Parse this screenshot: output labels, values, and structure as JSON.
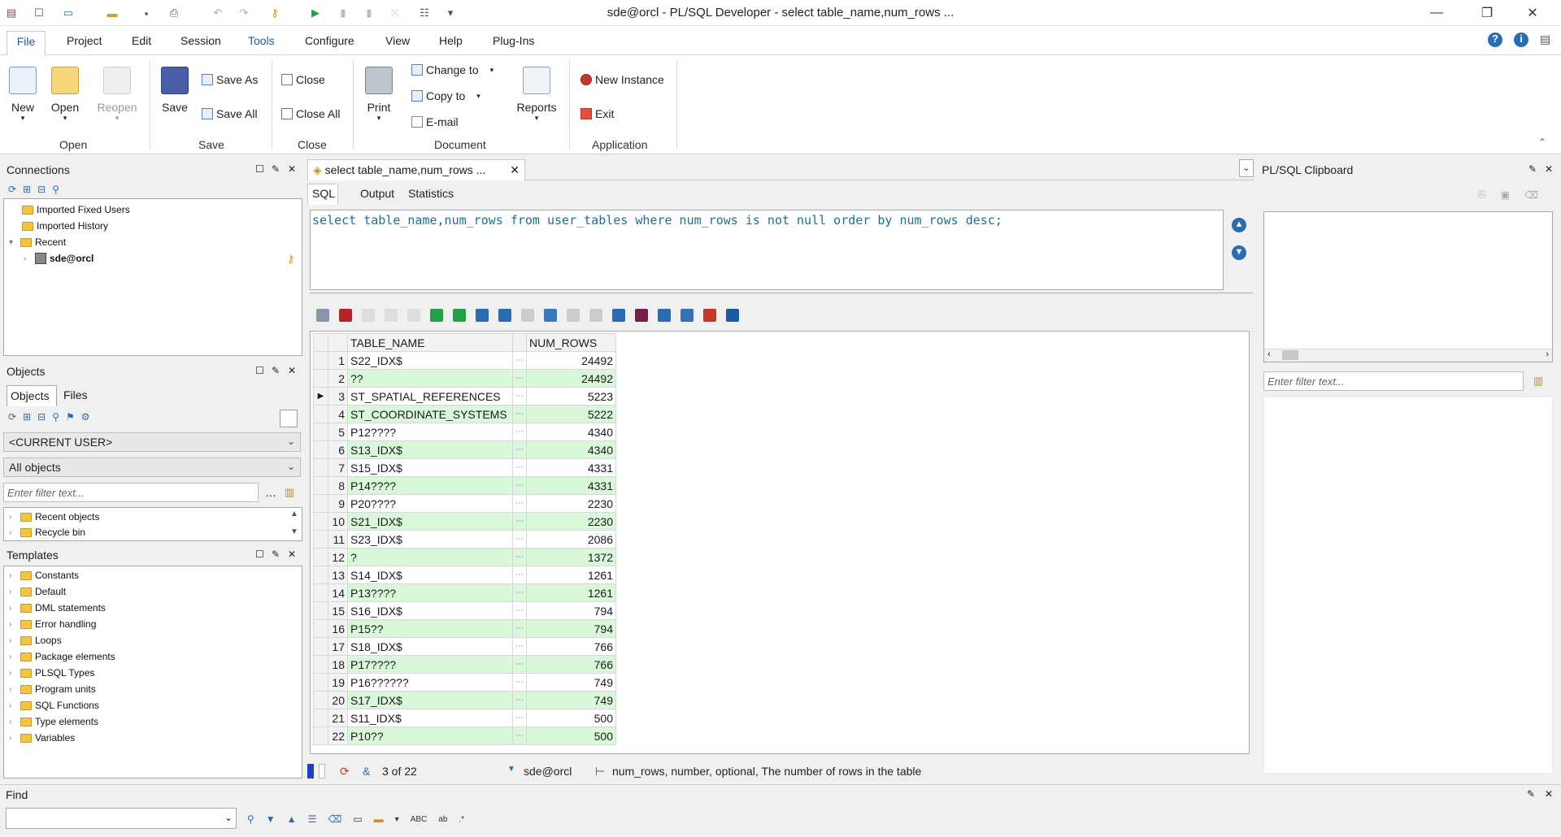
{
  "window": {
    "title": "sde@orcl - PL/SQL Developer - select table_name,num_rows ..."
  },
  "menu": [
    "File",
    "Project",
    "Edit",
    "Session",
    "Tools",
    "Configure",
    "View",
    "Help",
    "Plug-Ins"
  ],
  "ribbon": {
    "open_group": {
      "new": "New",
      "open": "Open",
      "reopen": "Reopen",
      "label": "Open"
    },
    "save_group": {
      "save": "Save",
      "save_as": "Save As",
      "save_all": "Save All",
      "label": "Save"
    },
    "close_group": {
      "close": "Close",
      "close_all": "Close All",
      "label": "Close"
    },
    "document_group": {
      "print": "Print",
      "change_to": "Change to",
      "copy_to": "Copy to",
      "email": "E-mail",
      "reports": "Reports",
      "label": "Document"
    },
    "application_group": {
      "new_instance": "New Instance",
      "exit": "Exit",
      "label": "Application"
    }
  },
  "connections": {
    "title": "Connections",
    "items": [
      "Imported Fixed Users",
      "Imported History",
      "Recent",
      "sde@orcl"
    ]
  },
  "objects": {
    "title": "Objects",
    "tabs": [
      "Objects",
      "Files"
    ],
    "user_combo": "<CURRENT USER>",
    "scope_combo": "All objects",
    "filter_placeholder": "Enter filter text...",
    "items": [
      "Recent objects",
      "Recycle bin"
    ]
  },
  "templates": {
    "title": "Templates",
    "items": [
      "Constants",
      "Default",
      "DML statements",
      "Error handling",
      "Loops",
      "Package elements",
      "PLSQL Types",
      "Program units",
      "SQL Functions",
      "Type elements",
      "Variables"
    ]
  },
  "editor": {
    "doc_tab": "select table_name,num_rows ...",
    "subtabs": [
      "SQL",
      "Output",
      "Statistics"
    ],
    "sql": "select table_name,num_rows from user_tables where num_rows is not null order by num_rows desc;"
  },
  "grid": {
    "columns": [
      "TABLE_NAME",
      "NUM_ROWS"
    ],
    "rows": [
      [
        "1",
        "S22_IDX$",
        "24492"
      ],
      [
        "2",
        "??",
        "24492"
      ],
      [
        "3",
        "ST_SPATIAL_REFERENCES",
        "5223"
      ],
      [
        "4",
        "ST_COORDINATE_SYSTEMS",
        "5222"
      ],
      [
        "5",
        "P12????",
        "4340"
      ],
      [
        "6",
        "S13_IDX$",
        "4340"
      ],
      [
        "7",
        "S15_IDX$",
        "4331"
      ],
      [
        "8",
        "P14????",
        "4331"
      ],
      [
        "9",
        "P20????",
        "2230"
      ],
      [
        "10",
        "S21_IDX$",
        "2230"
      ],
      [
        "11",
        "S23_IDX$",
        "2086"
      ],
      [
        "12",
        "?",
        "1372"
      ],
      [
        "13",
        "S14_IDX$",
        "1261"
      ],
      [
        "14",
        "P13????",
        "1261"
      ],
      [
        "15",
        "S16_IDX$",
        "794"
      ],
      [
        "16",
        "P15??",
        "794"
      ],
      [
        "17",
        "S18_IDX$",
        "766"
      ],
      [
        "18",
        "P17????",
        "766"
      ],
      [
        "19",
        "P16??????",
        "749"
      ],
      [
        "20",
        "S17_IDX$",
        "749"
      ],
      [
        "21",
        "S11_IDX$",
        "500"
      ],
      [
        "22",
        "P10??",
        "500"
      ]
    ]
  },
  "status": {
    "record": "3 of 22",
    "connection": "sde@orcl",
    "hint": "num_rows, number, optional, The number of rows in the table"
  },
  "clipboard": {
    "title": "PL/SQL Clipboard",
    "filter_placeholder": "Enter filter text..."
  },
  "find": {
    "title": "Find"
  }
}
